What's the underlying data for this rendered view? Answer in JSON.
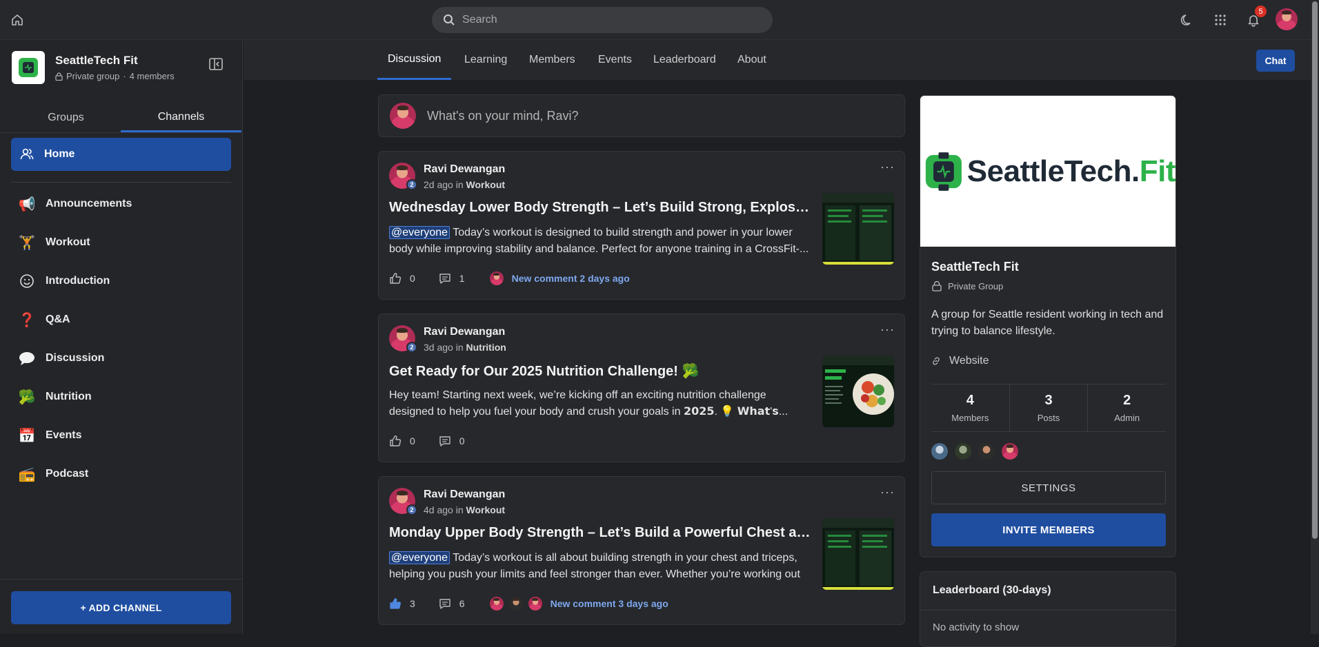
{
  "header": {
    "search_placeholder": "Search",
    "notification_count": "5"
  },
  "group": {
    "name": "SeattleTech Fit",
    "privacy": "Private group",
    "member_count": "4 members"
  },
  "sidebar": {
    "tabs": [
      "Groups",
      "Channels"
    ],
    "active_tab": "Channels",
    "home_label": "Home",
    "channels": [
      {
        "label": "Announcements",
        "icon": "megaphone-icon"
      },
      {
        "label": "Workout",
        "icon": "weightlifter-icon"
      },
      {
        "label": "Introduction",
        "icon": "smile-icon"
      },
      {
        "label": "Q&A",
        "icon": "question-icon"
      },
      {
        "label": "Discussion",
        "icon": "speech-bubble-icon"
      },
      {
        "label": "Nutrition",
        "icon": "broccoli-icon"
      },
      {
        "label": "Events",
        "icon": "calendar-icon"
      },
      {
        "label": "Podcast",
        "icon": "radio-icon"
      }
    ],
    "add_channel_label": "+ ADD CHANNEL"
  },
  "main": {
    "tabs": [
      "Discussion",
      "Learning",
      "Members",
      "Events",
      "Leaderboard",
      "About"
    ],
    "active_tab": "Discussion",
    "chat_label": "Chat",
    "composer_placeholder": "What's on your mind, Ravi?",
    "posts": [
      {
        "author": "Ravi Dewangan",
        "level": "2",
        "time": "2d ago",
        "in_word": "in",
        "channel": "Workout",
        "title": "Wednesday Lower Body Strength – Let’s Build Strong, Explosive Le...",
        "mention": "@everyone",
        "body": " Today’s workout is designed to build strength and power in your lower body while improving stability and balance. Perfect for anyone training in a CrossFit-...",
        "likes": "0",
        "comments": "1",
        "new_comment": "New comment 2 days ago"
      },
      {
        "author": "Ravi Dewangan",
        "level": "2",
        "time": "3d ago",
        "in_word": "in",
        "channel": "Nutrition",
        "title": "Get Ready for Our 2025 Nutrition Challenge! 🥦",
        "mention": "",
        "body": "Hey team! Starting next week, we’re kicking off an exciting nutrition challenge designed to help you fuel your body and crush your goals in 𝟮𝟬𝟮𝟱. 💡 𝗪𝗵𝗮𝘁'𝘀...",
        "likes": "0",
        "comments": "0",
        "new_comment": ""
      },
      {
        "author": "Ravi Dewangan",
        "level": "2",
        "time": "4d ago",
        "in_word": "in",
        "channel": "Workout",
        "title": "Monday Upper Body Strength – Let’s Build a Powerful Chest and Tr...",
        "mention": "@everyone",
        "body": " Today’s workout is all about building strength in your chest and triceps, helping you push your limits and feel stronger than ever. Whether you’re working out ...",
        "likes": "3",
        "comments": "6",
        "new_comment": "New comment 3 days ago"
      }
    ]
  },
  "about": {
    "banner_brand_a": "SeattleTech.",
    "banner_brand_b": "Fit",
    "name": "SeattleTech Fit",
    "privacy": "Private Group",
    "description": "A group for Seattle resident working in tech and trying to balance lifestyle.",
    "website_label": "Website",
    "stats": [
      {
        "value": "4",
        "label": "Members"
      },
      {
        "value": "3",
        "label": "Posts"
      },
      {
        "value": "2",
        "label": "Admin"
      }
    ],
    "settings_label": "SETTINGS",
    "invite_label": "INVITE MEMBERS"
  },
  "leaderboard": {
    "title": "Leaderboard (30-days)",
    "empty": "No activity to show"
  },
  "colors": {
    "accent": "#1f4ea1",
    "link": "#7fa8ee",
    "badge": "#d93025",
    "brand_green": "#2db24a"
  }
}
